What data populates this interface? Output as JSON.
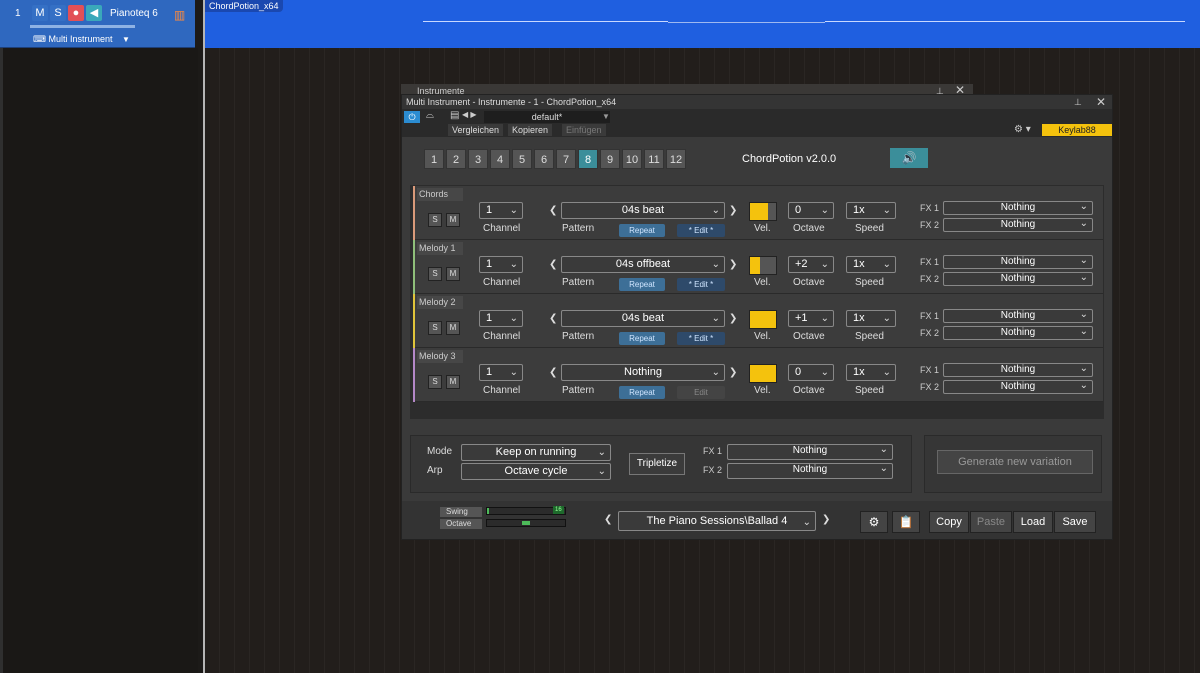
{
  "track": {
    "number": "1",
    "mute_label": "M",
    "solo_label": "S",
    "name": "Pianoteq 6",
    "instrument": "Multi Instrument"
  },
  "clip": {
    "name": "ChordPotion_x64"
  },
  "window": {
    "ghost_title": "Instrumente",
    "title": "Multi Instrument - Instrumente - 1 - ChordPotion_x64",
    "preset": "default*",
    "compare_label": "Vergleichen",
    "copy_label": "Kopieren",
    "paste_label": "Einfügen",
    "device": "Keylab88"
  },
  "plugin": {
    "title": "ChordPotion v2.0.0",
    "pattern_buttons": [
      "1",
      "2",
      "3",
      "4",
      "5",
      "6",
      "7",
      "8",
      "9",
      "10",
      "11",
      "12"
    ],
    "active_pattern": "8",
    "tracks": [
      {
        "name": "Chords",
        "channel": "1",
        "pattern": "04s beat",
        "repeat": "Repeat",
        "edit": "* Edit *",
        "vel": 0.7,
        "octave": "0",
        "speed": "1x",
        "fx1": "Nothing",
        "fx2": "Nothing"
      },
      {
        "name": "Melody 1",
        "channel": "1",
        "pattern": "04s offbeat",
        "repeat": "Repeat",
        "edit": "* Edit *",
        "vel": 0.4,
        "octave": "+2",
        "speed": "1x",
        "fx1": "Nothing",
        "fx2": "Nothing"
      },
      {
        "name": "Melody 2",
        "channel": "1",
        "pattern": "04s beat",
        "repeat": "Repeat",
        "edit": "* Edit *",
        "vel": 1.0,
        "octave": "+1",
        "speed": "1x",
        "fx1": "Nothing",
        "fx2": "Nothing"
      },
      {
        "name": "Melody 3",
        "channel": "1",
        "pattern": "Nothing",
        "repeat": "Repeat",
        "edit": "Edit",
        "vel": 1.0,
        "octave": "0",
        "speed": "1x",
        "fx1": "Nothing",
        "fx2": "Nothing"
      }
    ],
    "labels": {
      "channel": "Channel",
      "pattern": "Pattern",
      "vel": "Vel.",
      "octave": "Octave",
      "speed": "Speed",
      "fx1": "FX 1",
      "fx2": "FX 2",
      "solo": "S",
      "mute": "M",
      "mode": "Mode",
      "arp": "Arp"
    },
    "mode_value": "Keep on running",
    "arp_value": "Octave cycle",
    "tripletize": "Tripletize",
    "global_fx1": "Nothing",
    "global_fx2": "Nothing",
    "generate": "Generate new variation",
    "swing_label": "Swing",
    "octave_label": "Octave",
    "swing_value": "16",
    "preset_name": "The Piano Sessions\\Ballad 4",
    "copy": "Copy",
    "paste": "Paste",
    "load": "Load",
    "save": "Save"
  },
  "colors": {
    "accent": "#3b8e9a",
    "velocity": "#f4c20d",
    "track_blue": "#2f68bf"
  }
}
